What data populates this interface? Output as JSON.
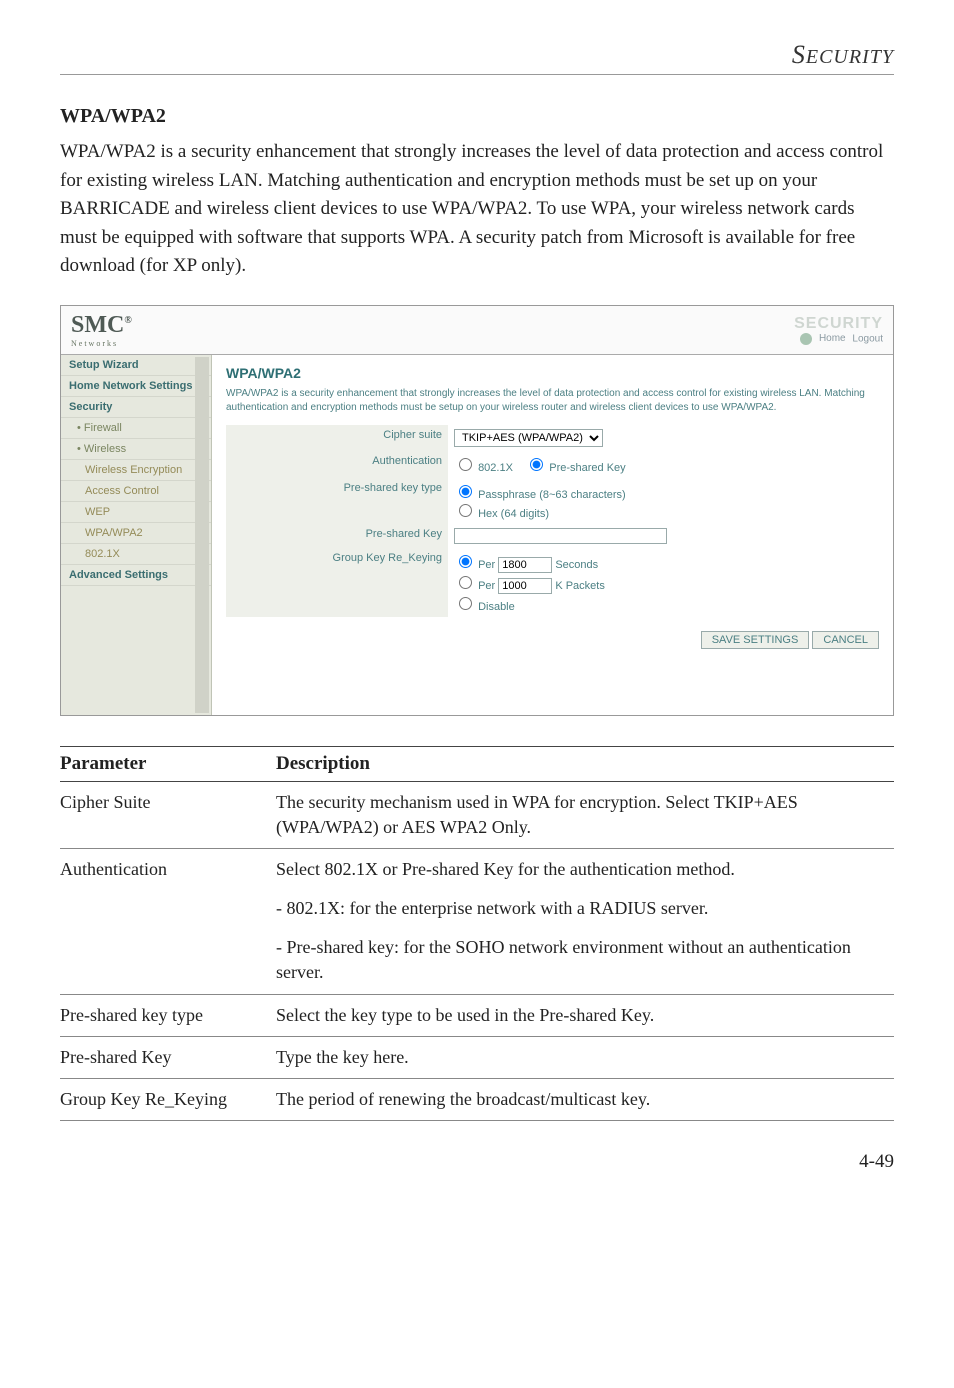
{
  "header": {
    "running": "Security",
    "running_first": "S"
  },
  "section_title": "WPA/WPA2",
  "intro": "WPA/WPA2 is a security enhancement that strongly increases the level of data protection and access control for existing wireless LAN. Matching authentication and encryption methods must be set up on your BARRICADE and wireless client devices to use WPA/WPA2. To use WPA, your wireless network cards must be equipped with software that supports WPA. A security patch from Microsoft is available for free download (for XP only).",
  "screenshot": {
    "logo": "SMC",
    "logo_sub": "Networks",
    "brand": "SECURITY",
    "home": "Home",
    "logout": "Logout",
    "sidebar": [
      {
        "label": "Setup Wizard",
        "cls": "lvl1"
      },
      {
        "label": "Home Network Settings",
        "cls": "lvl1"
      },
      {
        "label": "Security",
        "cls": "lvl1"
      },
      {
        "label": "Firewall",
        "cls": "lvl2 bullet"
      },
      {
        "label": "Wireless",
        "cls": "lvl2 bullet"
      },
      {
        "label": "Wireless Encryption",
        "cls": "lvl3"
      },
      {
        "label": "Access Control",
        "cls": "lvl3"
      },
      {
        "label": "WEP",
        "cls": "lvl3"
      },
      {
        "label": "WPA/WPA2",
        "cls": "lvl3"
      },
      {
        "label": "802.1X",
        "cls": "lvl3"
      },
      {
        "label": "Advanced Settings",
        "cls": "lvl1"
      }
    ],
    "panel_title": "WPA/WPA2",
    "panel_note": "WPA/WPA2 is a security enhancement that strongly increases the level of data protection and access control for existing wireless LAN. Matching authentication and encryption methods must be setup on your wireless router and wireless client devices to use WPA/WPA2.",
    "rows": {
      "cipher": {
        "label": "Cipher suite",
        "value": "TKIP+AES (WPA/WPA2)"
      },
      "auth": {
        "label": "Authentication",
        "opt1": "802.1X",
        "opt2": "Pre-shared Key"
      },
      "ptype": {
        "label": "Pre-shared key type",
        "opt1": "Passphrase (8~63 characters)",
        "opt2": "Hex (64 digits)"
      },
      "pkey": {
        "label": "Pre-shared Key"
      },
      "rekey": {
        "label": "Group Key Re_Keying",
        "per1": "Per",
        "v1": "1800",
        "u1": "Seconds",
        "per2": "Per",
        "v2": "1000",
        "u2": "K Packets",
        "dis": "Disable"
      }
    },
    "btn_save": "SAVE SETTINGS",
    "btn_cancel": "CANCEL"
  },
  "table": {
    "head_param": "Parameter",
    "head_desc": "Description",
    "rows": [
      {
        "param": "Cipher Suite",
        "desc": "The security mechanism used in WPA for encryption. Select TKIP+AES (WPA/WPA2) or AES WPA2 Only."
      },
      {
        "param": "Authentication",
        "desc": "Select 802.1X or Pre-shared Key for the authentication method.",
        "sub1": "- 802.1X: for the enterprise network with a RADIUS server.",
        "sub2": "- Pre-shared key: for the SOHO network environment without an authentication server."
      },
      {
        "param": "Pre-shared key type",
        "desc": "Select the key type to be used in the Pre-shared Key."
      },
      {
        "param": "Pre-shared Key",
        "desc": "Type the key here."
      },
      {
        "param": "Group Key Re_Keying",
        "desc": "The period of renewing the broadcast/multicast key."
      }
    ]
  },
  "page_number": "4-49"
}
